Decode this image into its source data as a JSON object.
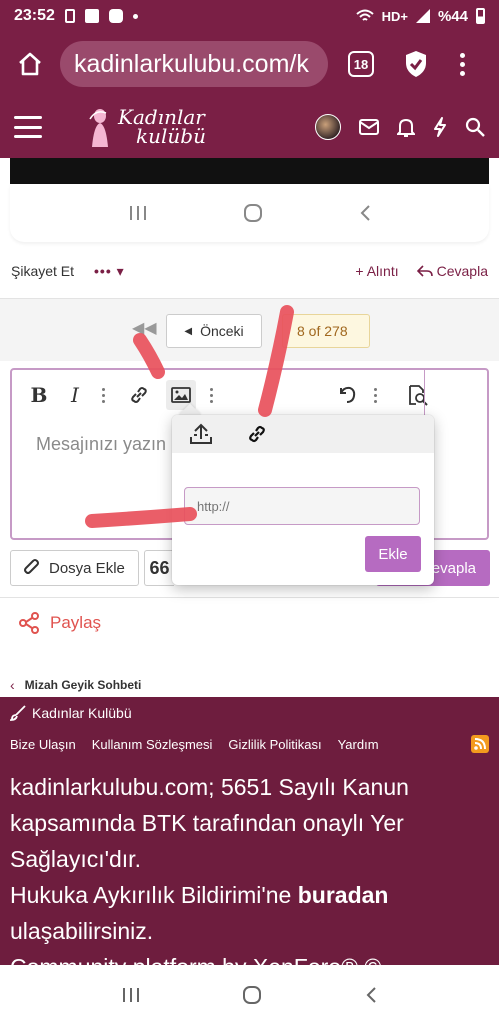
{
  "status_bar": {
    "time": "23:52",
    "network": "HD+",
    "battery": "%44"
  },
  "browser": {
    "url": "kadinlarkulubu.com/k",
    "tab_count": "18"
  },
  "site": {
    "logo_line1": "Kadınlar",
    "logo_line2": "kulübü"
  },
  "post_actions": {
    "report": "Şikayet Et",
    "quote": "+ Alıntı",
    "reply": "Cevapla"
  },
  "pagination": {
    "prev": "Önceki",
    "page": "8 of 278"
  },
  "editor": {
    "placeholder": "Mesajınızı yazın"
  },
  "buttons": {
    "attach": "Dosya Ekle",
    "reply": "Cevapla"
  },
  "share": {
    "label": "Paylaş"
  },
  "breadcrumb": {
    "label": "Mizah Geyik Sohbeti"
  },
  "image_popup": {
    "url_placeholder": "http://",
    "insert": "Ekle"
  },
  "footer": {
    "brand": "Kadınlar Kulübü",
    "links": [
      "Bize Ulaşın",
      "Kullanım Sözleşmesi",
      "Gizlilik Politikası",
      "Yardım"
    ],
    "line1": "kadinlarkulubu.com; 5651 Sayılı Kanun kapsamında BTK tarafından onaylı Yer Sağlayıcı'dır.",
    "line2_a": "Hukuka Aykırılık Bildirimi'ne ",
    "line2_bold": "buradan",
    "line2_b": " ulaşabilirsiniz.",
    "line3": "Community platform by XenForo® ©"
  },
  "colors": {
    "brand": "#7a1f45",
    "accent": "#b66bc1",
    "annotation": "#e8505b"
  },
  "icons": [
    "home-icon",
    "shield-check-icon",
    "hamburger-icon",
    "mail-icon",
    "bell-icon",
    "bolt-icon",
    "search-icon",
    "bold-icon",
    "italic-icon",
    "link-icon",
    "image-icon",
    "undo-icon",
    "preview-icon",
    "upload-icon",
    "paperclip-icon",
    "share-icon",
    "rss-icon"
  ]
}
